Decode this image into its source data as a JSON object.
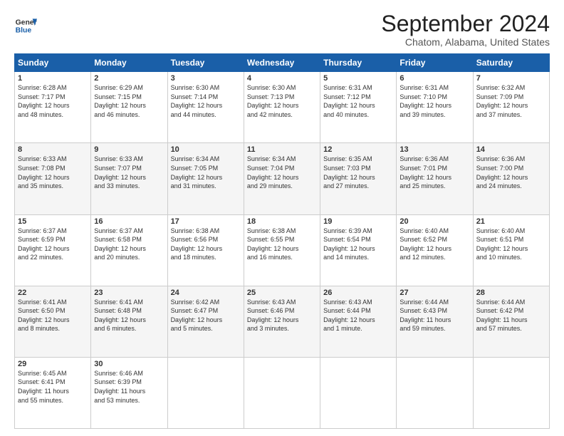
{
  "header": {
    "logo_line1": "General",
    "logo_line2": "Blue",
    "title": "September 2024",
    "subtitle": "Chatom, Alabama, United States"
  },
  "days_of_week": [
    "Sunday",
    "Monday",
    "Tuesday",
    "Wednesday",
    "Thursday",
    "Friday",
    "Saturday"
  ],
  "weeks": [
    [
      {
        "day": "1",
        "info": "Sunrise: 6:28 AM\nSunset: 7:17 PM\nDaylight: 12 hours\nand 48 minutes."
      },
      {
        "day": "2",
        "info": "Sunrise: 6:29 AM\nSunset: 7:15 PM\nDaylight: 12 hours\nand 46 minutes."
      },
      {
        "day": "3",
        "info": "Sunrise: 6:30 AM\nSunset: 7:14 PM\nDaylight: 12 hours\nand 44 minutes."
      },
      {
        "day": "4",
        "info": "Sunrise: 6:30 AM\nSunset: 7:13 PM\nDaylight: 12 hours\nand 42 minutes."
      },
      {
        "day": "5",
        "info": "Sunrise: 6:31 AM\nSunset: 7:12 PM\nDaylight: 12 hours\nand 40 minutes."
      },
      {
        "day": "6",
        "info": "Sunrise: 6:31 AM\nSunset: 7:10 PM\nDaylight: 12 hours\nand 39 minutes."
      },
      {
        "day": "7",
        "info": "Sunrise: 6:32 AM\nSunset: 7:09 PM\nDaylight: 12 hours\nand 37 minutes."
      }
    ],
    [
      {
        "day": "8",
        "info": "Sunrise: 6:33 AM\nSunset: 7:08 PM\nDaylight: 12 hours\nand 35 minutes."
      },
      {
        "day": "9",
        "info": "Sunrise: 6:33 AM\nSunset: 7:07 PM\nDaylight: 12 hours\nand 33 minutes."
      },
      {
        "day": "10",
        "info": "Sunrise: 6:34 AM\nSunset: 7:05 PM\nDaylight: 12 hours\nand 31 minutes."
      },
      {
        "day": "11",
        "info": "Sunrise: 6:34 AM\nSunset: 7:04 PM\nDaylight: 12 hours\nand 29 minutes."
      },
      {
        "day": "12",
        "info": "Sunrise: 6:35 AM\nSunset: 7:03 PM\nDaylight: 12 hours\nand 27 minutes."
      },
      {
        "day": "13",
        "info": "Sunrise: 6:36 AM\nSunset: 7:01 PM\nDaylight: 12 hours\nand 25 minutes."
      },
      {
        "day": "14",
        "info": "Sunrise: 6:36 AM\nSunset: 7:00 PM\nDaylight: 12 hours\nand 24 minutes."
      }
    ],
    [
      {
        "day": "15",
        "info": "Sunrise: 6:37 AM\nSunset: 6:59 PM\nDaylight: 12 hours\nand 22 minutes."
      },
      {
        "day": "16",
        "info": "Sunrise: 6:37 AM\nSunset: 6:58 PM\nDaylight: 12 hours\nand 20 minutes."
      },
      {
        "day": "17",
        "info": "Sunrise: 6:38 AM\nSunset: 6:56 PM\nDaylight: 12 hours\nand 18 minutes."
      },
      {
        "day": "18",
        "info": "Sunrise: 6:38 AM\nSunset: 6:55 PM\nDaylight: 12 hours\nand 16 minutes."
      },
      {
        "day": "19",
        "info": "Sunrise: 6:39 AM\nSunset: 6:54 PM\nDaylight: 12 hours\nand 14 minutes."
      },
      {
        "day": "20",
        "info": "Sunrise: 6:40 AM\nSunset: 6:52 PM\nDaylight: 12 hours\nand 12 minutes."
      },
      {
        "day": "21",
        "info": "Sunrise: 6:40 AM\nSunset: 6:51 PM\nDaylight: 12 hours\nand 10 minutes."
      }
    ],
    [
      {
        "day": "22",
        "info": "Sunrise: 6:41 AM\nSunset: 6:50 PM\nDaylight: 12 hours\nand 8 minutes."
      },
      {
        "day": "23",
        "info": "Sunrise: 6:41 AM\nSunset: 6:48 PM\nDaylight: 12 hours\nand 6 minutes."
      },
      {
        "day": "24",
        "info": "Sunrise: 6:42 AM\nSunset: 6:47 PM\nDaylight: 12 hours\nand 5 minutes."
      },
      {
        "day": "25",
        "info": "Sunrise: 6:43 AM\nSunset: 6:46 PM\nDaylight: 12 hours\nand 3 minutes."
      },
      {
        "day": "26",
        "info": "Sunrise: 6:43 AM\nSunset: 6:44 PM\nDaylight: 12 hours\nand 1 minute."
      },
      {
        "day": "27",
        "info": "Sunrise: 6:44 AM\nSunset: 6:43 PM\nDaylight: 11 hours\nand 59 minutes."
      },
      {
        "day": "28",
        "info": "Sunrise: 6:44 AM\nSunset: 6:42 PM\nDaylight: 11 hours\nand 57 minutes."
      }
    ],
    [
      {
        "day": "29",
        "info": "Sunrise: 6:45 AM\nSunset: 6:41 PM\nDaylight: 11 hours\nand 55 minutes."
      },
      {
        "day": "30",
        "info": "Sunrise: 6:46 AM\nSunset: 6:39 PM\nDaylight: 11 hours\nand 53 minutes."
      },
      {
        "day": "",
        "info": ""
      },
      {
        "day": "",
        "info": ""
      },
      {
        "day": "",
        "info": ""
      },
      {
        "day": "",
        "info": ""
      },
      {
        "day": "",
        "info": ""
      }
    ]
  ]
}
